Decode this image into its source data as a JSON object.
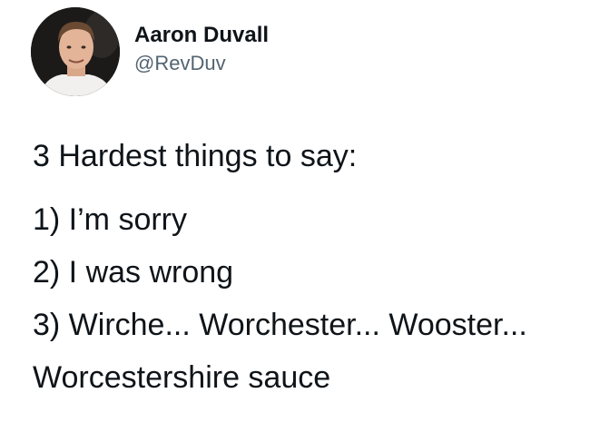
{
  "author": {
    "display_name": "Aaron Duvall",
    "handle": "@RevDuv",
    "avatar_icon": "profile-photo"
  },
  "tweet": {
    "intro": "3 Hardest things to say:",
    "items": [
      "1) I’m sorry",
      "2) I was wrong",
      "3) Wirche... Worchester... Wooster..."
    ],
    "continuation": "Worcestershire sauce"
  },
  "colors": {
    "text": "#0f1419",
    "secondary_text": "#536471",
    "background": "#ffffff"
  }
}
